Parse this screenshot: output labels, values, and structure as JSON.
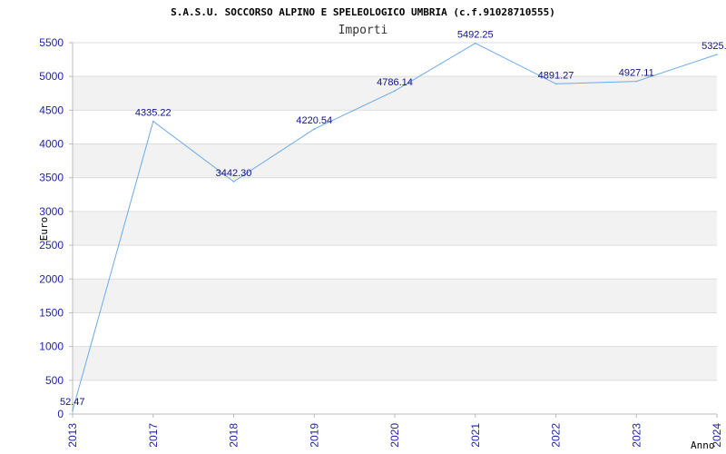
{
  "chart_data": {
    "type": "line",
    "title": "S.A.S.U. SOCCORSO ALPINO E SPELEOLOGICO UMBRIA (c.f.91028710555)",
    "subtitle": "Importi",
    "xlabel": "Anno",
    "ylabel": "Euro",
    "categories": [
      "2013",
      "2017",
      "2018",
      "2019",
      "2020",
      "2021",
      "2022",
      "2023",
      "2024"
    ],
    "series": [
      {
        "name": "Importi",
        "values": [
          52.47,
          4335.22,
          3442.3,
          4220.54,
          4786.14,
          5492.25,
          4891.27,
          4927.11,
          5325.0
        ],
        "labels": [
          "52.47",
          "4335.22",
          "3442.30",
          "4220.54",
          "4786.14",
          "5492.25",
          "4891.27",
          "4927.11",
          "5325.0"
        ]
      }
    ],
    "ylim": [
      0,
      5500
    ],
    "yticks": [
      0,
      500,
      1000,
      1500,
      2000,
      2500,
      3000,
      3500,
      4000,
      4500,
      5000,
      5500
    ],
    "grid": true,
    "bands": "alternating",
    "colors": {
      "line": "#6aaae8",
      "band": "#f2f2f2",
      "gridline": "#dddddd",
      "tick": "#1f1fa8",
      "label": "#10108a"
    }
  }
}
